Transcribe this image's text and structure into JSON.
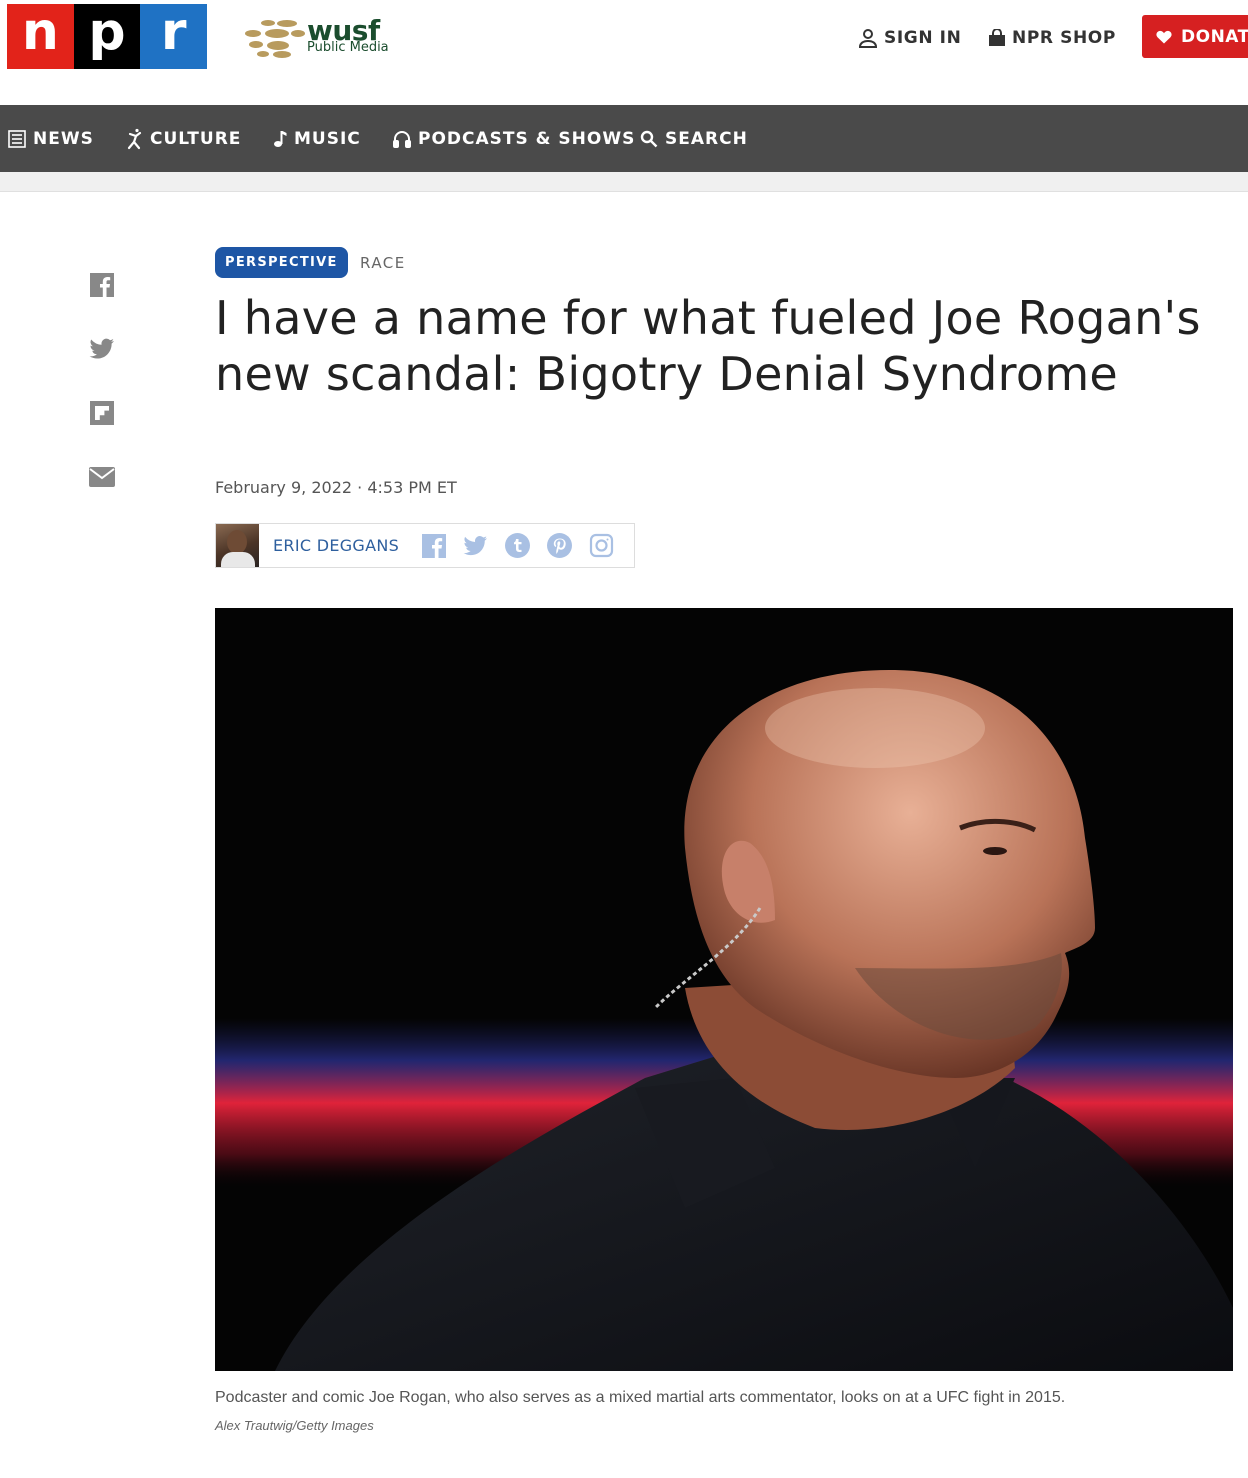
{
  "header": {
    "npr_logo": {
      "letters": [
        "n",
        "p",
        "r"
      ],
      "colors": [
        "#e2231a",
        "#000000",
        "#1f72c4"
      ]
    },
    "station_logo": {
      "name": "wusf",
      "subtitle": "Public Media"
    },
    "sign_in_label": "SIGN IN",
    "shop_label": "NPR SHOP",
    "donate_label": "DONATE",
    "donate_color": "#d62021"
  },
  "nav": {
    "items": [
      {
        "label": "NEWS",
        "icon": "news-icon"
      },
      {
        "label": "CULTURE",
        "icon": "culture-icon"
      },
      {
        "label": "MUSIC",
        "icon": "music-note-icon"
      },
      {
        "label": "PODCASTS & SHOWS",
        "icon": "headphones-icon"
      },
      {
        "label": "SEARCH",
        "icon": "search-icon"
      }
    ]
  },
  "share": {
    "icons": [
      "facebook-icon",
      "twitter-icon",
      "flipboard-icon",
      "email-icon"
    ]
  },
  "article": {
    "tag_primary": "PERSPECTIVE",
    "tag_secondary": "RACE",
    "headline": "I have a name for what fueled Joe Rogan's new scandal: Bigotry Denial Syndrome",
    "date": "February 9, 2022 · 4:53 PM ET",
    "author": "ERIC DEGGANS",
    "author_social_icons": [
      "facebook-icon",
      "twitter-icon",
      "tumblr-icon",
      "pinterest-icon",
      "instagram-icon"
    ],
    "image_caption": "Podcaster and comic Joe Rogan, who also serves as a mixed martial arts commentator, looks on at a UFC fight in 2015.",
    "image_credit": "Alex Trautwig/Getty Images"
  }
}
